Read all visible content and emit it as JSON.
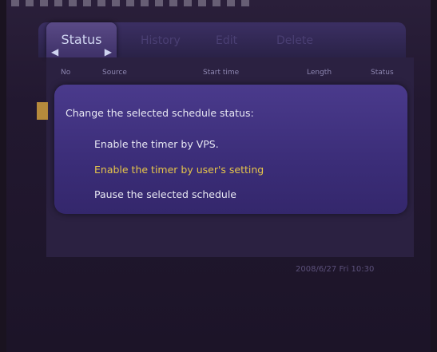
{
  "tabs": [
    {
      "label": "Status"
    },
    {
      "label": "History"
    },
    {
      "label": "Edit"
    },
    {
      "label": "Delete"
    }
  ],
  "columns": [
    "No",
    "Source",
    "Start time",
    "Length",
    "Status"
  ],
  "dialog": {
    "title": "Change the selected schedule status:",
    "options": [
      {
        "label": "Enable the timer by VPS."
      },
      {
        "label": "Enable the timer by user's setting"
      },
      {
        "label": "Pause the selected schedule"
      }
    ]
  },
  "footer": {
    "datetime": "2008/6/27 Fri 10:30"
  },
  "colors": {
    "dialog": "#3b2d78",
    "selected_text": "#e6c54a",
    "active_tab_text": "#cfd4f0"
  }
}
